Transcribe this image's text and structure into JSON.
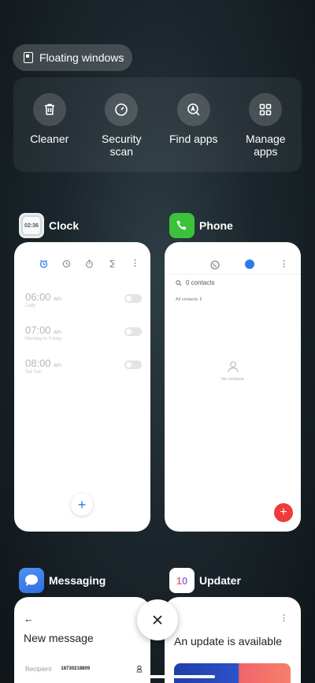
{
  "floating_windows": {
    "label": "Floating windows",
    "icon": "floating-window-icon"
  },
  "tools": [
    {
      "label": "Cleaner",
      "icon": "trash-icon"
    },
    {
      "label": "Security scan",
      "icon": "security-scan-icon"
    },
    {
      "label": "Find apps",
      "icon": "find-apps-icon"
    },
    {
      "label": "Manage apps",
      "icon": "grid-icon"
    }
  ],
  "apps": {
    "clock": {
      "name": "Clock",
      "icon_text": "02:36",
      "alarms": [
        {
          "time": "06:00",
          "ampm": "am",
          "desc": "Daily"
        },
        {
          "time": "07:00",
          "ampm": "am",
          "desc": "Monday to Friday"
        },
        {
          "time": "08:00",
          "ampm": "am",
          "desc": "Sat Sun"
        }
      ],
      "fab": "+"
    },
    "phone": {
      "name": "Phone",
      "search_placeholder": "0 contacts",
      "filter": "All contacts",
      "empty": "No contacts",
      "fab": "+"
    },
    "messaging": {
      "name": "Messaging",
      "back": "←",
      "title": "New message",
      "recipient_label": "Recipient",
      "recipient_value": "18730218809"
    },
    "updater": {
      "name": "Updater",
      "icon_text": "10",
      "menu": "⋮",
      "title": "An update is available"
    }
  },
  "colors": {
    "accent_blue": "#2b7ce9",
    "phone_green": "#3cc13b",
    "messaging_blue": "#2f6fe0",
    "fab_red": "#ef3b3b"
  }
}
